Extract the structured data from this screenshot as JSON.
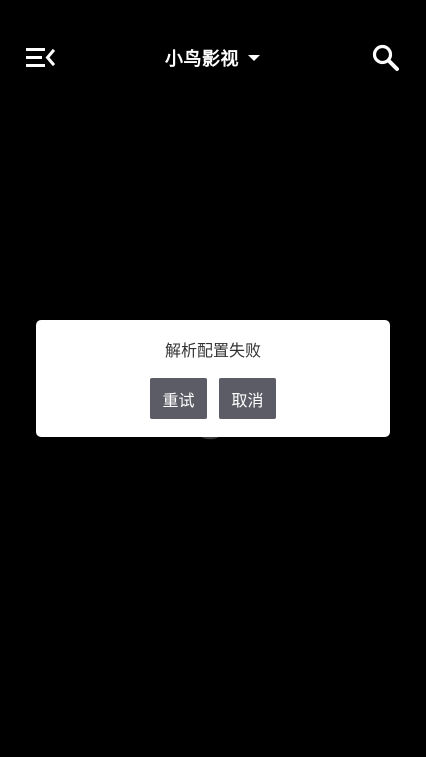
{
  "header": {
    "menu_icon": "menu-collapse-icon",
    "title": "小鸟影视",
    "dropdown_icon": "caret-down-icon",
    "search_icon": "search-icon"
  },
  "content": {
    "loading_icon": "loading-spinner-icon"
  },
  "dialog": {
    "message": "解析配置失败",
    "retry_label": "重试",
    "cancel_label": "取消"
  },
  "colors": {
    "background": "#000000",
    "header_text": "#ffffff",
    "dialog_background": "#ffffff",
    "dialog_text": "#333333",
    "button_background": "#5c5c66",
    "button_text": "#ffffff"
  }
}
